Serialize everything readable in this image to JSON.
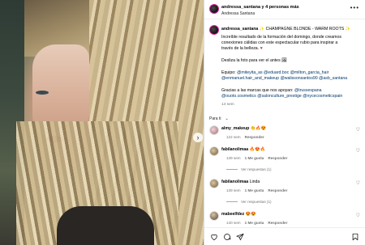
{
  "post": {
    "author": "andressa_santana",
    "header_title": "andressa_santana y 4 personas más",
    "header_subtitle": "Andressa Santana",
    "more_label": "•••"
  },
  "caption": {
    "author": "andressa_santana",
    "title_text": "CHAMPAGNE BLONDE - WARM ROOTS",
    "lines": [
      "Increíble resultado de la formación del domingo, donde creamos",
      "conexiones cálidas con este espectacular rubio para inspirar a",
      "través de la belleza."
    ],
    "desliza": "Desliza la foto para ver el antes",
    "equipo_label": "Equipo:",
    "equipo_tags_1": "@miteyita_as @eduard.boc @milton_garcia_hair",
    "equipo_tags_2": "@enmanuel.hair_and_makeup @walissonsantos90 @asb_santana",
    "gracias": "Gracias a las marcas que nos apoyan:",
    "brand_1": "@trussespana",
    "brand_line": "@ouoto.cosmetics @salonculture_prestige @nycecosmeticspain",
    "time": "14 sem"
  },
  "filter": {
    "label": "Para ti",
    "chevron": "⌄"
  },
  "comments": [
    {
      "user": "almy_makeup",
      "text": "👏🔥😍",
      "time": "122 sem",
      "reply": "Responder"
    },
    {
      "user": "fabilanolimaa",
      "text": "🔥😍🔥",
      "time": "139 sem",
      "likes": "1 Me gusta",
      "reply": "Responder",
      "view_replies": "Ver respuestas (1)"
    },
    {
      "user": "fabilanolimaa",
      "text": "Linda",
      "time": "139 sem",
      "likes": "1 Me gusta",
      "reply": "Responder",
      "view_replies": "Ver respuestas (1)"
    },
    {
      "user": "mabeelfdez",
      "text": "😍😍",
      "time": "140 sem",
      "likes": "1 Me gusta",
      "reply": "Responder"
    }
  ],
  "icons": {
    "next": "›",
    "heart": "♡"
  }
}
